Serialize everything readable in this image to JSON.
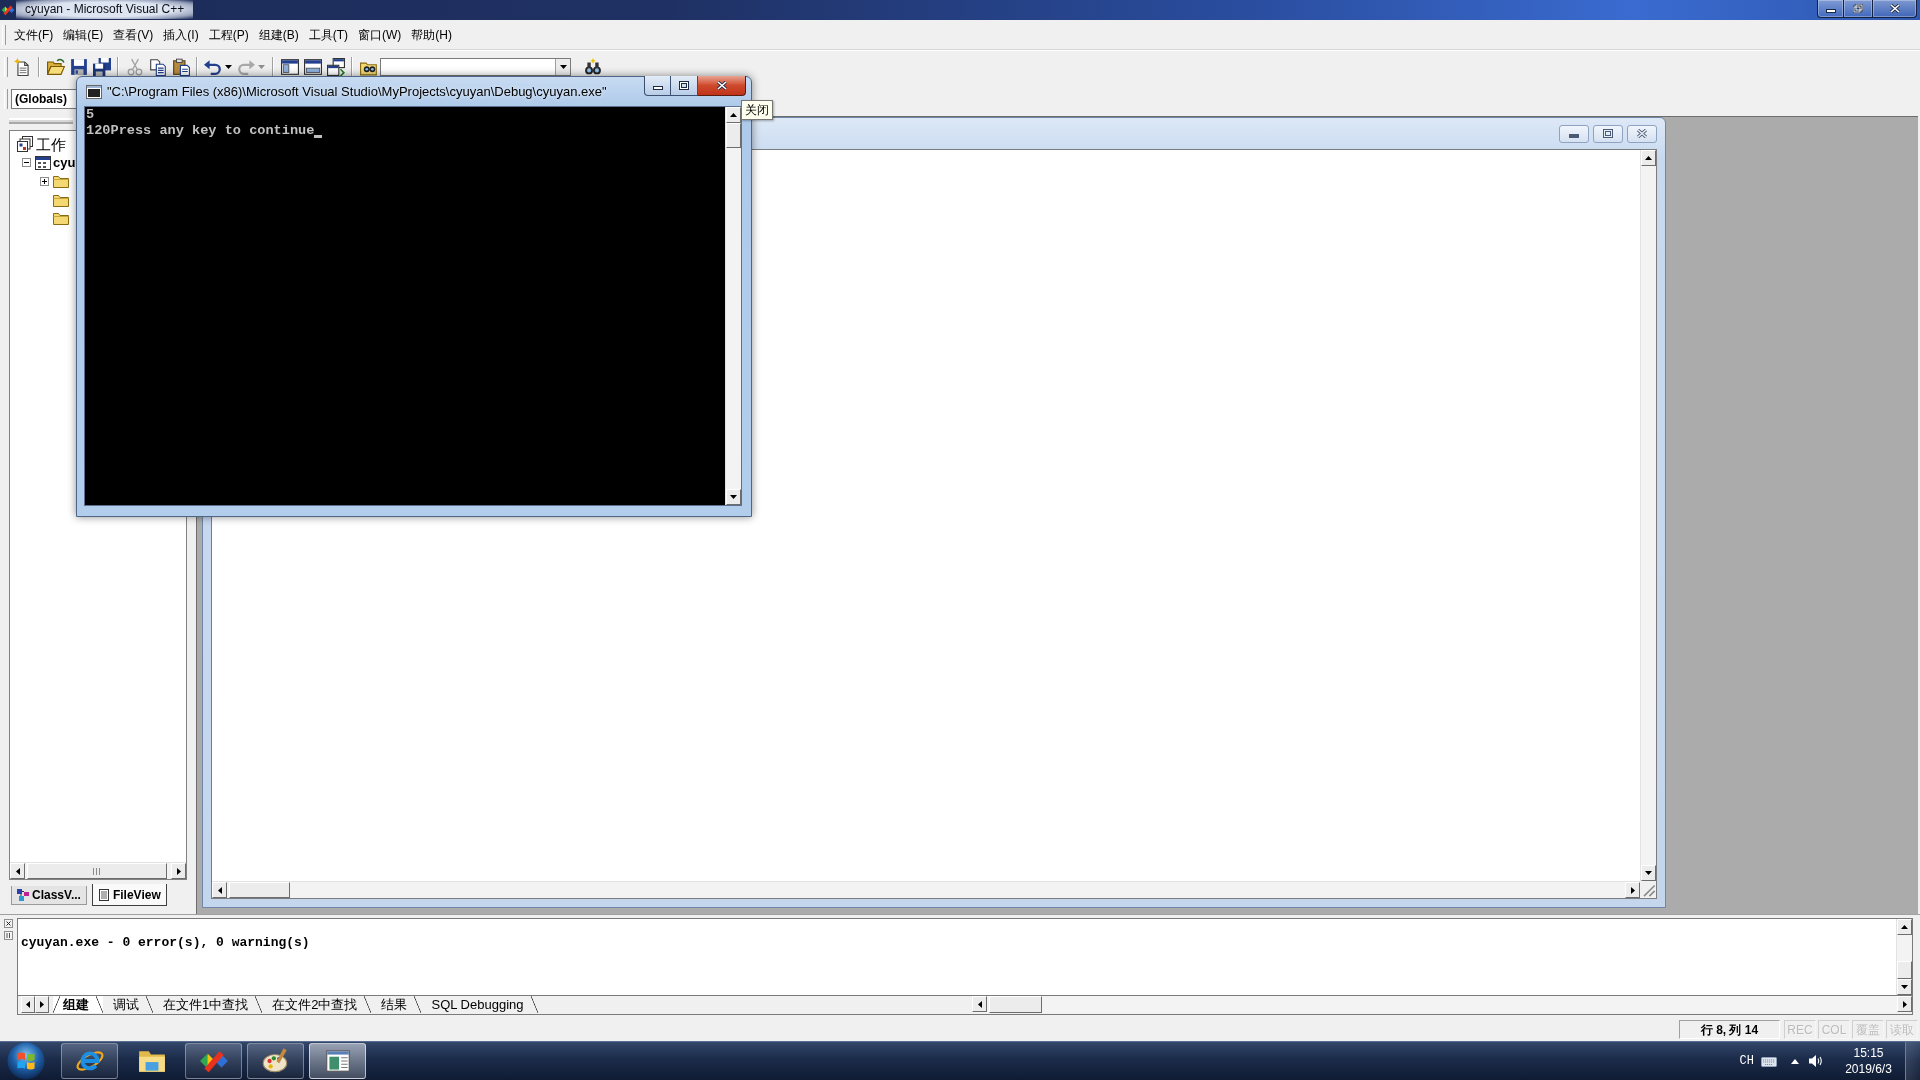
{
  "window": {
    "title": "cyuyan - Microsoft Visual C++"
  },
  "menu": [
    {
      "label": "文件(F)"
    },
    {
      "label": "编辑(E)"
    },
    {
      "label": "查看(V)"
    },
    {
      "label": "插入(I)"
    },
    {
      "label": "工程(P)"
    },
    {
      "label": "组建(B)"
    },
    {
      "label": "工具(T)"
    },
    {
      "label": "窗口(W)"
    },
    {
      "label": "帮助(H)"
    }
  ],
  "toolbar": [
    {
      "kind": "new",
      "disabled": false
    },
    {
      "kind": "separator"
    },
    {
      "kind": "open",
      "disabled": false
    },
    {
      "kind": "save",
      "disabled": false
    },
    {
      "kind": "save_all",
      "disabled": false
    },
    {
      "kind": "separator"
    },
    {
      "kind": "cut",
      "disabled": true
    },
    {
      "kind": "copy",
      "disabled": false
    },
    {
      "kind": "paste",
      "disabled": false
    },
    {
      "kind": "separator"
    },
    {
      "kind": "undo",
      "disabled": false
    },
    {
      "kind": "redo",
      "disabled": true
    },
    {
      "kind": "separator"
    },
    {
      "kind": "workspace",
      "disabled": false
    },
    {
      "kind": "output",
      "disabled": false
    },
    {
      "kind": "window_list",
      "disabled": false
    },
    {
      "kind": "separator"
    },
    {
      "kind": "find_in_files",
      "disabled": false
    },
    {
      "kind": "combo"
    },
    {
      "kind": "find",
      "disabled": false
    }
  ],
  "wizard_bar": {
    "scope": "(Globals)"
  },
  "workspace": {
    "tree": [
      {
        "kind": "workspace",
        "label": "工作",
        "children": [
          {
            "kind": "project",
            "label": "cyu",
            "expanded": true,
            "children": [
              {
                "kind": "folder",
                "expanded": false
              },
              {
                "kind": "folder"
              },
              {
                "kind": "folder"
              }
            ]
          }
        ]
      }
    ],
    "tabs": [
      {
        "kind": "classes",
        "label": "ClassV...",
        "selected": false
      },
      {
        "kind": "files",
        "label": "FileView",
        "selected": true
      }
    ]
  },
  "console": {
    "title": "\"C:\\Program Files (x86)\\Microsoft Visual Studio\\MyProjects\\cyuyan\\Debug\\cyuyan.exe\"",
    "lines": [
      "5",
      "120Press any key to continue"
    ],
    "cursor": true,
    "tooltip": "关闭"
  },
  "output": {
    "text": "cyuyan.exe - 0 error(s), 0 warning(s)",
    "tabs": [
      {
        "label": "组建",
        "selected": true
      },
      {
        "label": "调试",
        "selected": false
      },
      {
        "label": "在文件1中查找",
        "selected": false
      },
      {
        "label": "在文件2中查找",
        "selected": false
      },
      {
        "label": "结果",
        "selected": false
      },
      {
        "label": "SQL Debugging",
        "selected": false
      }
    ]
  },
  "status_bar": {
    "panels": [
      {
        "text": "行 8, 列 14",
        "disabled": false
      },
      {
        "text": "REC",
        "disabled": true
      },
      {
        "text": "COL",
        "disabled": true
      },
      {
        "text": "覆盖",
        "disabled": true
      },
      {
        "text": "读取",
        "disabled": true
      }
    ]
  },
  "taskbar": {
    "buttons": [
      {
        "kind": "browser",
        "running": true,
        "selected": false
      },
      {
        "kind": "folder",
        "running": false,
        "selected": false
      },
      {
        "kind": "ide",
        "running": true,
        "selected": false
      },
      {
        "kind": "paint",
        "running": true,
        "selected": false
      },
      {
        "kind": "console",
        "running": true,
        "selected": true
      }
    ],
    "tray": {
      "language": "CH",
      "time": "15:15",
      "date": "2019/6/3"
    }
  }
}
